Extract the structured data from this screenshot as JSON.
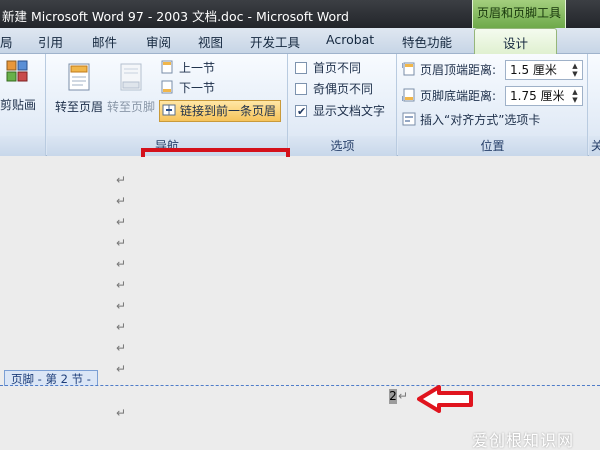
{
  "titlebar": {
    "title": "新建 Microsoft Word 97 - 2003 文档.doc - Microsoft Word",
    "context_tab": "页眉和页脚工具"
  },
  "tabs": [
    "局",
    "引用",
    "邮件",
    "审阅",
    "视图",
    "开发工具",
    "Acrobat",
    "特色功能",
    "设计"
  ],
  "active_tab": "设计",
  "ribbon": {
    "clip_group": {
      "paste_label": "剪贴画"
    },
    "nav_group": {
      "label": "导航",
      "goto_header": "转至页眉",
      "goto_footer": "转至页脚",
      "prev_section": "上一节",
      "next_section": "下一节",
      "link_previous": "链接到前一条页眉"
    },
    "options_group": {
      "label": "选项",
      "diff_first": "首页不同",
      "diff_odd_even": "奇偶页不同",
      "show_doc_text": "显示文档文字",
      "diff_first_checked": false,
      "diff_odd_even_checked": false,
      "show_doc_text_checked": true
    },
    "position_group": {
      "label": "位置",
      "header_top_label": "页眉顶端距离:",
      "header_top_value": "1.5 厘米",
      "footer_bottom_label": "页脚底端距离:",
      "footer_bottom_value": "1.75 厘米",
      "insert_align_tab": "插入“对齐方式”选项卡"
    },
    "close_group": {
      "label": "关"
    }
  },
  "document": {
    "paragraph_mark": "↵",
    "footer_tag": "页脚 - 第 2 节 -",
    "page_number": "2"
  },
  "watermark": "爱创根知识网",
  "colors": {
    "highlight": "#d4111b",
    "context_green": "#6ea94a"
  }
}
